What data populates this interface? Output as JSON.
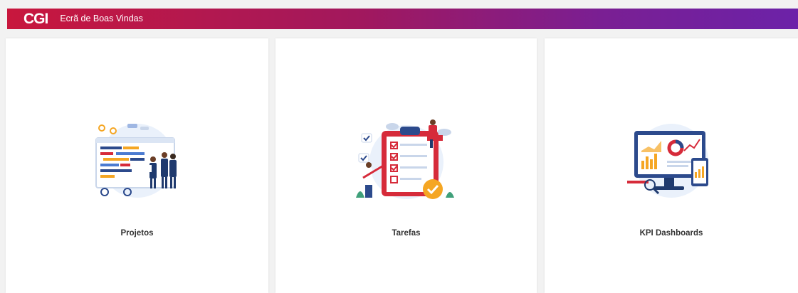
{
  "header": {
    "logo": "CGI",
    "title": "Ecrã de Boas Vindas"
  },
  "cards": [
    {
      "label": "Projetos",
      "illustration": "team-planning-board-illustration"
    },
    {
      "label": "Tarefas",
      "illustration": "task-checklist-illustration"
    },
    {
      "label": "KPI Dashboards",
      "illustration": "analytics-dashboard-illustration"
    }
  ],
  "colors": {
    "header_start": "#c8173d",
    "header_end": "#6c22a8",
    "accent_red": "#d62b3a",
    "accent_blue": "#2c4a8c",
    "accent_orange": "#f5a623"
  }
}
